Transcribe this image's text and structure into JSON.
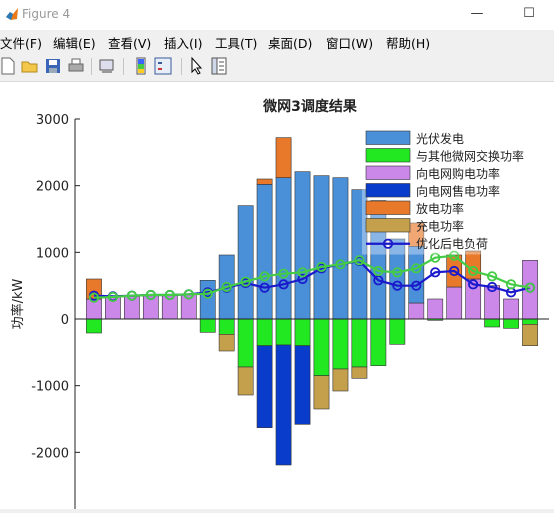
{
  "window": {
    "title": "Figure 4",
    "minimize_glyph": "—",
    "maximize_glyph": "☐"
  },
  "menu": [
    "文件(F)",
    "编辑(E)",
    "查看(V)",
    "插入(I)",
    "工具(T)",
    "桌面(D)",
    "窗口(W)",
    "帮助(H)"
  ],
  "toolbar": [
    "new-figure-icon",
    "open-file-icon",
    "save-icon",
    "print-icon",
    "print-preview-icon",
    "colorbar-icon",
    "legend-icon",
    "pointer-icon",
    "property-editor-icon"
  ],
  "colors": {
    "pv": "#4a90d9",
    "exchange": "#22e822",
    "buy": "#cc88e8",
    "sell": "#0a3ccc",
    "discharge": "#e8782a",
    "charge": "#c4a04c",
    "load": "#1a1acc",
    "optimized": "#44cc44"
  },
  "chart_data": {
    "type": "bar",
    "title": "微网3调度结果",
    "xlabel": "",
    "ylabel": "功率/kW",
    "xlim": [
      0,
      25
    ],
    "ylim": [
      -3000,
      3000
    ],
    "xticks": [
      0,
      5,
      10,
      15,
      20,
      25
    ],
    "yticks": [
      3000,
      2000,
      1000,
      0,
      -1000,
      -2000,
      -3000
    ],
    "grid": false,
    "legend_position": "top-right",
    "x": [
      1,
      2,
      3,
      4,
      5,
      6,
      7,
      8,
      9,
      10,
      11,
      12,
      13,
      14,
      15,
      16,
      17,
      18,
      19,
      20,
      21,
      22,
      23,
      24
    ],
    "positive_stack_order": [
      "buy",
      "pv",
      "discharge"
    ],
    "negative_stack_order": [
      "exchange",
      "sell",
      "charge"
    ],
    "series": [
      {
        "key": "pv",
        "name": "光伏发电",
        "kind": "bar",
        "values": [
          0,
          0,
          0,
          0,
          0,
          0,
          580,
          960,
          1700,
          2020,
          2120,
          2210,
          2150,
          2120,
          1940,
          1780,
          1200,
          850,
          0,
          0,
          0,
          0,
          0,
          0
        ]
      },
      {
        "key": "exchange",
        "name": "与其他微网交换功率",
        "kind": "bar",
        "values": [
          -210,
          0,
          0,
          0,
          0,
          0,
          -200,
          -230,
          -720,
          -400,
          -390,
          -400,
          -850,
          -750,
          -720,
          -700,
          -380,
          0,
          -20,
          0,
          0,
          -120,
          -140,
          -80
        ]
      },
      {
        "key": "buy",
        "name": "向电网购电功率",
        "kind": "bar",
        "values": [
          300,
          330,
          340,
          350,
          350,
          370,
          0,
          0,
          0,
          0,
          0,
          0,
          0,
          0,
          0,
          0,
          0,
          240,
          300,
          480,
          600,
          500,
          300,
          880
        ]
      },
      {
        "key": "sell",
        "name": "向电网售电功率",
        "kind": "bar",
        "values": [
          0,
          0,
          0,
          0,
          0,
          0,
          0,
          0,
          0,
          -1230,
          -1800,
          -1180,
          0,
          0,
          0,
          0,
          0,
          0,
          0,
          0,
          0,
          0,
          0,
          0
        ]
      },
      {
        "key": "discharge",
        "name": "放电功率",
        "kind": "bar",
        "values": [
          300,
          0,
          0,
          0,
          0,
          0,
          0,
          0,
          0,
          80,
          600,
          0,
          0,
          0,
          0,
          0,
          0,
          350,
          0,
          480,
          420,
          0,
          0,
          0
        ]
      },
      {
        "key": "charge",
        "name": "充电功率",
        "kind": "bar",
        "values": [
          0,
          0,
          0,
          0,
          0,
          0,
          0,
          -250,
          -420,
          0,
          0,
          0,
          -500,
          -330,
          -170,
          0,
          0,
          0,
          0,
          0,
          0,
          0,
          0,
          -320
        ]
      },
      {
        "key": "load",
        "name": "优化后电负荷",
        "kind": "line",
        "marker": "circle",
        "values": [
          350,
          340,
          350,
          360,
          360,
          370,
          400,
          470,
          540,
          470,
          520,
          600,
          760,
          820,
          870,
          580,
          500,
          500,
          700,
          720,
          520,
          480,
          400,
          470
        ]
      },
      {
        "key": "optimized",
        "name": "",
        "kind": "line",
        "marker": "circle",
        "values": [
          320,
          330,
          350,
          360,
          360,
          370,
          380,
          480,
          560,
          640,
          680,
          700,
          780,
          820,
          880,
          720,
          700,
          760,
          920,
          950,
          720,
          640,
          520,
          470
        ]
      }
    ]
  }
}
